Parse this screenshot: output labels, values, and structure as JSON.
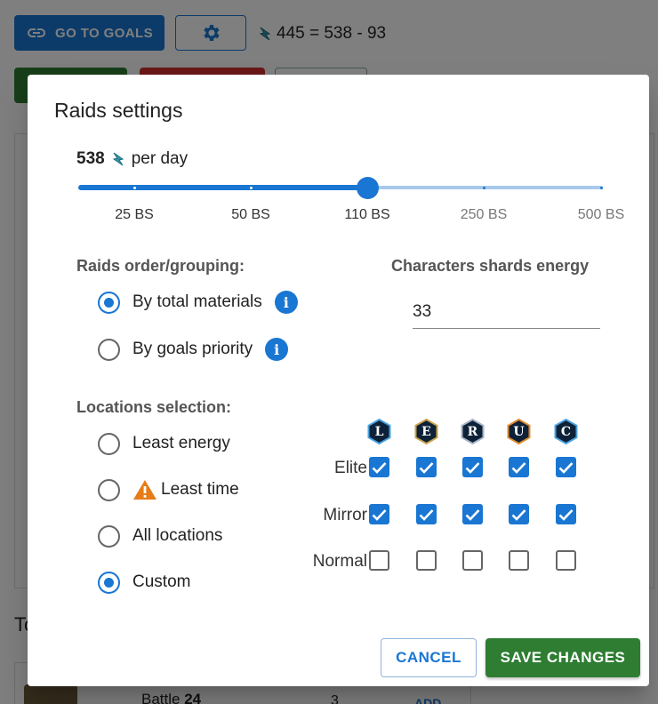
{
  "background": {
    "goals_button": "GO TO GOALS",
    "energy_equation": "445 = 538 - 93",
    "section_title": "To",
    "battle_label": "Battle",
    "battle_number": "24",
    "count": "3",
    "add_label": "ADD"
  },
  "dialog": {
    "title": "Raids settings",
    "energy_value": "538",
    "per_day_label": "per day",
    "slider": {
      "marks": [
        "25 BS",
        "50 BS",
        "110 BS",
        "250 BS",
        "500 BS"
      ],
      "selected_index": 2
    },
    "order_label": "Raids order/grouping:",
    "order_options": [
      "By total materials",
      "By goals priority"
    ],
    "order_selected": 0,
    "shards_label": "Characters shards energy",
    "shards_value": "33",
    "locations_label": "Locations selection:",
    "location_options": [
      "Least energy",
      "Least time",
      "All locations",
      "Custom"
    ],
    "location_selected": 3,
    "rarities": [
      {
        "letter": "L",
        "color": "#4aa3e0"
      },
      {
        "letter": "E",
        "color": "#c8a048"
      },
      {
        "letter": "R",
        "color": "#a8b4c4"
      },
      {
        "letter": "U",
        "color": "#e08a2e"
      },
      {
        "letter": "C",
        "color": "#4aa3e0"
      }
    ],
    "grid_rows": [
      {
        "label": "Elite",
        "checked": [
          true,
          true,
          true,
          true,
          true
        ]
      },
      {
        "label": "Mirror",
        "checked": [
          true,
          true,
          true,
          true,
          true
        ]
      },
      {
        "label": "Normal",
        "checked": [
          false,
          false,
          false,
          false,
          false
        ]
      }
    ],
    "cancel_label": "CANCEL",
    "save_label": "SAVE CHANGES"
  },
  "colors": {
    "primary": "#1976d2",
    "success": "#2e7d32",
    "danger": "#d32f2f",
    "warning": "#e67c17"
  }
}
